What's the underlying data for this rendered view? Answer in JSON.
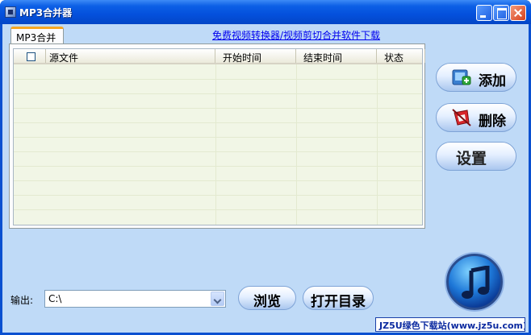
{
  "window": {
    "title": "MP3合并器"
  },
  "tabs": [
    {
      "label": "MP3合并"
    }
  ],
  "top_link": "免费视频转换器/视频剪切合并软件下载",
  "list": {
    "columns": [
      "源文件",
      "开始时间",
      "结束时间",
      "状态"
    ],
    "rows": []
  },
  "buttons": {
    "add": "添加",
    "delete": "删除",
    "settings": "设置",
    "browse": "浏览",
    "open_dir": "打开目录"
  },
  "output": {
    "label": "输出:",
    "value": "C:\\"
  },
  "watermark": "JZ5U绿色下载站(www.jz5u.com)",
  "colors": {
    "titlebar": "#0450dc",
    "client_bg": "#bfdaf7",
    "list_bg": "#f1f6e6",
    "tab_accent": "#f5a623"
  },
  "icons": [
    "app-icon",
    "add-icon",
    "delete-icon",
    "music-note-icon",
    "minimize-icon",
    "maximize-icon",
    "close-icon",
    "chevron-down-icon"
  ]
}
